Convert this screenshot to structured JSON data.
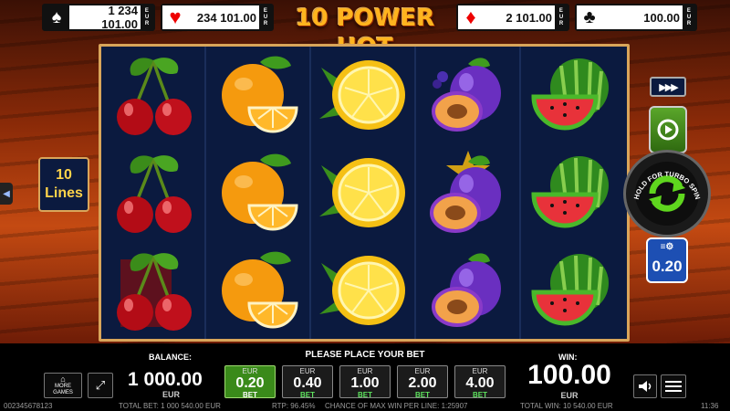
{
  "jackpots": [
    {
      "suit": "spade",
      "glyph": "♠",
      "amount": "1 234 101.00",
      "currency": "EUR"
    },
    {
      "suit": "heart",
      "glyph": "♥",
      "amount": "234 101.00",
      "currency": "EUR"
    },
    {
      "suit": "diamond",
      "glyph": "♦",
      "amount": "2 101.00",
      "currency": "EUR"
    },
    {
      "suit": "club",
      "glyph": "♣",
      "amount": "100.00",
      "currency": "EUR"
    }
  ],
  "title": "10 POWER HOT",
  "reels": [
    [
      "cherry",
      "cherry",
      "cherry"
    ],
    [
      "orange",
      "orange",
      "orange"
    ],
    [
      "lemon",
      "lemon",
      "lemon"
    ],
    [
      "plum",
      "plum",
      "plum"
    ],
    [
      "watermelon",
      "watermelon",
      "watermelon"
    ]
  ],
  "lines": {
    "count": "10",
    "label": "Lines"
  },
  "controls": {
    "fast_forward": "▶▶▶",
    "spin_label": "HOLD FOR TURBO SPIN",
    "bet_chip_value": "0.20"
  },
  "balance": {
    "label": "BALANCE:",
    "value": "1 000.00",
    "currency": "EUR"
  },
  "message": "PLEASE PLACE YOUR BET",
  "bets": [
    {
      "currency": "EUR",
      "value": "0.20",
      "tag": "BET",
      "active": true
    },
    {
      "currency": "EUR",
      "value": "0.40",
      "tag": "BET",
      "active": false
    },
    {
      "currency": "EUR",
      "value": "1.00",
      "tag": "BET",
      "active": false
    },
    {
      "currency": "EUR",
      "value": "2.00",
      "tag": "BET",
      "active": false
    },
    {
      "currency": "EUR",
      "value": "4.00",
      "tag": "BET",
      "active": false
    }
  ],
  "win": {
    "label": "WIN:",
    "value": "100.00",
    "currency": "EUR"
  },
  "more_games": "MORE GAMES",
  "status": {
    "session_id": "002345678123",
    "total_bet": "TOTAL BET: 1 000 540.00 EUR",
    "rtp": "RTP: 96.45%",
    "chance": "CHANCE OF MAX WIN PER LINE: 1:25907",
    "total_win": "TOTAL WIN: 10 540.00 EUR",
    "time": "11:36"
  }
}
